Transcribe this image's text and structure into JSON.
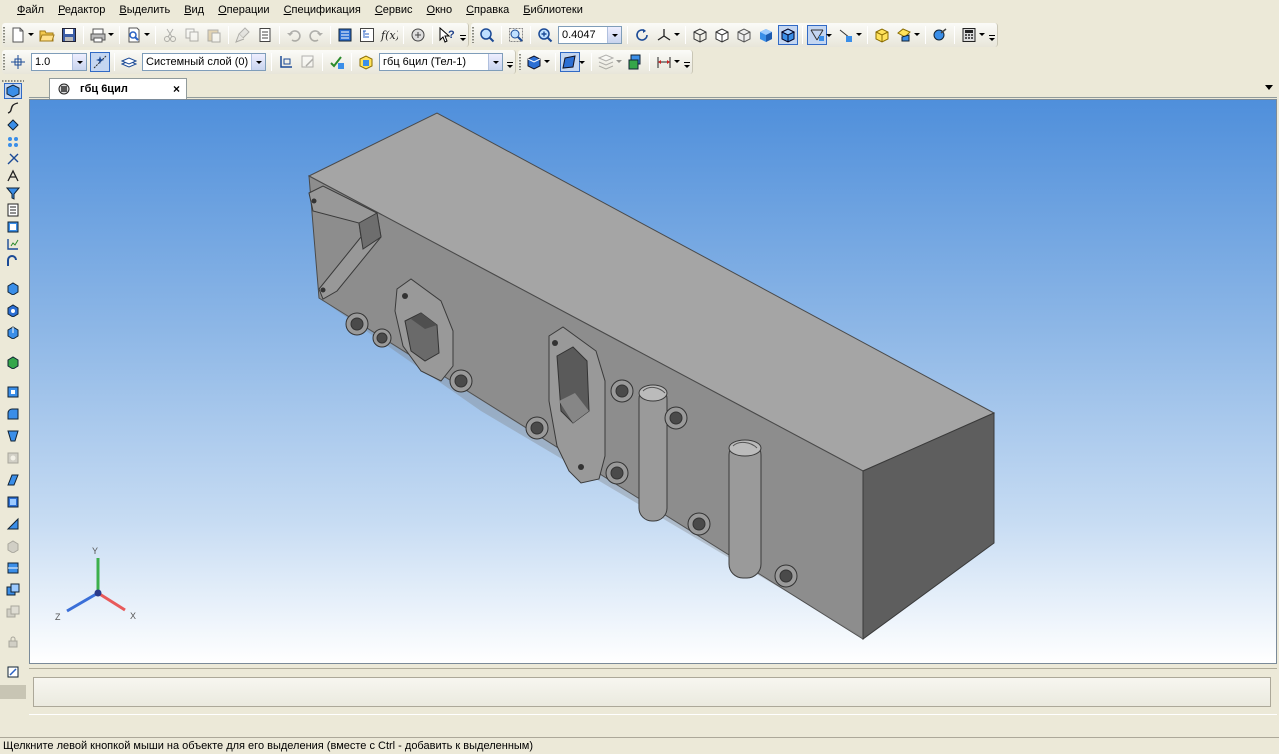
{
  "menu": {
    "items": [
      {
        "label": "Файл",
        "u": "Ф",
        "rest": "айл"
      },
      {
        "label": "Редактор",
        "u": "Р",
        "rest": "едактор"
      },
      {
        "label": "Выделить",
        "u": "В",
        "rest": "ыделить"
      },
      {
        "label": "Вид",
        "u": "В",
        "rest": "ид"
      },
      {
        "label": "Операции",
        "u": "О",
        "rest": "перации"
      },
      {
        "label": "Спецификация",
        "u": "С",
        "rest": "пецификация"
      },
      {
        "label": "Сервис",
        "u": "С",
        "rest": "ервис"
      },
      {
        "label": "Окно",
        "u": "О",
        "rest": "кно"
      },
      {
        "label": "Справка",
        "u": "С",
        "rest": "правка"
      },
      {
        "label": "Библиотеки",
        "u": "Б",
        "rest": "иблиотеки"
      }
    ]
  },
  "toolbar1": {
    "zoom_value": "0.4047"
  },
  "toolbar2": {
    "step_value": "1.0",
    "layer_value": "Системный слой (0)",
    "body_value": "гбц 6цил (Тел-1)"
  },
  "document": {
    "tab_title": "гбц 6цил"
  },
  "axes": {
    "x_label": "X",
    "y_label": "Y",
    "z_label": "Z"
  },
  "colors": {
    "selection_blue": "#316ac5",
    "part_top": "#a5a5a5",
    "part_front": "#8d8d8d",
    "part_side": "#5c5c5c",
    "axis_x": "#e85a5a",
    "axis_y": "#3cb04c",
    "axis_z": "#3a6fd8"
  },
  "status": {
    "hint": "Щелкните левой кнопкой мыши на объекте для его выделения (вместе с Ctrl - добавить к выделенным)"
  }
}
